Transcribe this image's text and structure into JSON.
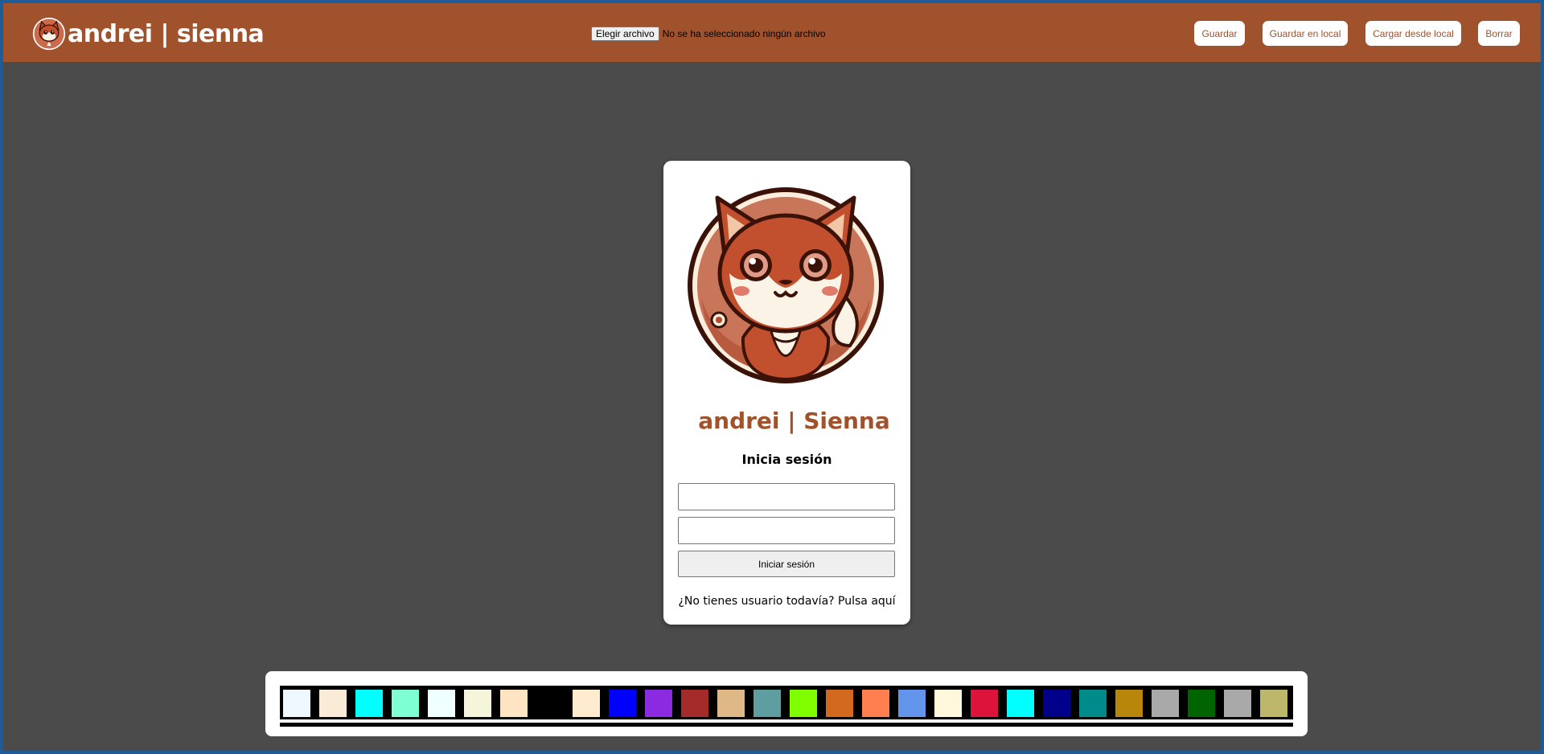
{
  "header": {
    "brand": "andrei | sienna",
    "file_button": "Elegir archivo",
    "file_status": "No se ha seleccionado ningún archivo",
    "buttons": {
      "save": "Guardar",
      "save_local": "Guardar en local",
      "load_local": "Cargar desde local",
      "clear": "Borrar"
    }
  },
  "login": {
    "title": "andrei | Sienna",
    "subtitle": "Inicia sesión",
    "username_value": "",
    "password_value": "",
    "submit": "Iniciar sesión",
    "register_link": "¿No tienes usuario todavía? Pulsa aquí"
  },
  "colors": {
    "brand": "#a0522d",
    "canvas": "#4b4b4b"
  },
  "palette": [
    "#f0f8ff",
    "#faebd7",
    "#00ffff",
    "#7fffd4",
    "#f0ffff",
    "#f5f5dc",
    "#ffe4c4",
    "#000000",
    "#ffebcd",
    "#0000ff",
    "#8a2be2",
    "#a52a2a",
    "#deb887",
    "#5f9ea0",
    "#7fff00",
    "#d2691e",
    "#ff7f50",
    "#6495ed",
    "#fff8dc",
    "#dc143c",
    "#00ffff",
    "#00008b",
    "#008b8b",
    "#b8860b",
    "#a9a9a9",
    "#006400",
    "#a9a9a9",
    "#bdb76b"
  ]
}
